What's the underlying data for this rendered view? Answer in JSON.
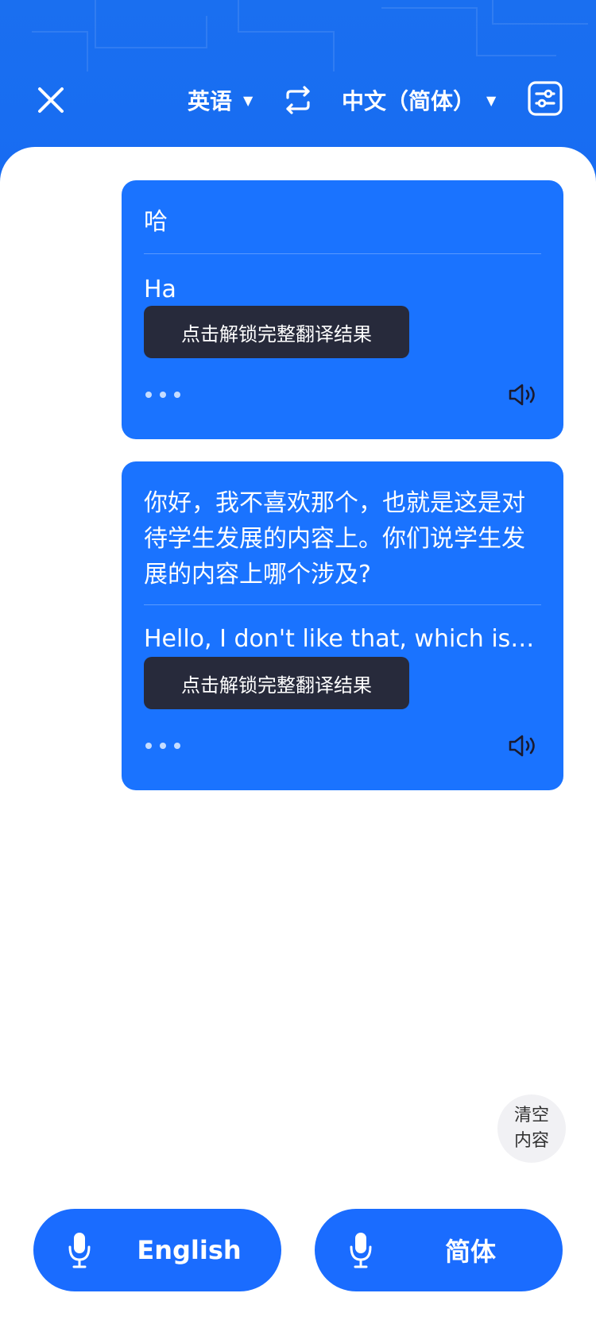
{
  "header": {
    "source_language": "英语",
    "target_language": "中文（简体）",
    "caret": "▼",
    "background_color": "#176cf2"
  },
  "messages": [
    {
      "source_text": "哈",
      "translation": "Ha",
      "unlock_label": "点击解锁完整翻译结果"
    },
    {
      "source_text": "你好，我不喜欢那个，也就是这是对待学生发展的内容上。你们说学生发展的内容上哪个涉及?",
      "translation": "Hello, I don't like that, which is…",
      "unlock_label": "点击解锁完整翻译结果"
    }
  ],
  "clear_button": {
    "line1": "清空",
    "line2": "内容"
  },
  "footer": {
    "left_button": "English",
    "right_button": "简体",
    "button_color": "#1a6cff"
  },
  "colors": {
    "bubble": "#1a73ff",
    "unlock_overlay": "#272a3b"
  }
}
